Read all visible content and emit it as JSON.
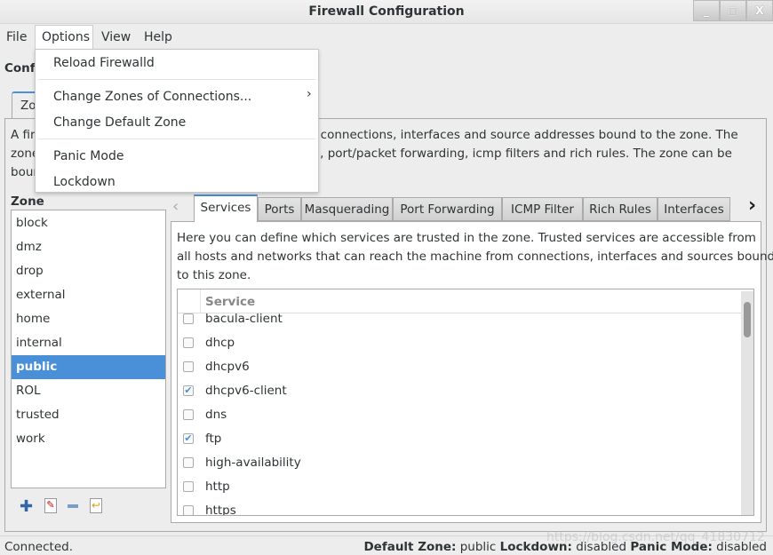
{
  "window": {
    "title": "Firewall Configuration",
    "minimize": "_",
    "maximize": "□",
    "close": "X"
  },
  "menubar": [
    "File",
    "Options",
    "View",
    "Help"
  ],
  "options_menu": {
    "reload": "Reload Firewalld",
    "change_zones": "Change Zones of Connections...",
    "change_default": "Change Default Zone",
    "panic": "Panic Mode",
    "lockdown": "Lockdown",
    "submenu_arrow": "›"
  },
  "partial": {
    "config_label": "Conf",
    "outer_tab": "Zo",
    "desc_left": [
      "A fir",
      "zone",
      "bour"
    ],
    "desc_right": [
      "rk connections, interfaces and source addresses bound to the zone. The",
      "ng, port/packet forwarding, icmp filters and rich rules. The zone can be"
    ]
  },
  "zone_label": "Zone",
  "zones": [
    "block",
    "dmz",
    "drop",
    "external",
    "home",
    "internal",
    "public",
    "ROL",
    "trusted",
    "work"
  ],
  "selected_zone": "public",
  "inner_tabs": [
    "Services",
    "Ports",
    "Masquerading",
    "Port Forwarding",
    "ICMP Filter",
    "Rich Rules",
    "Interfaces"
  ],
  "active_tab": "Services",
  "services_desc": [
    "Here you can define which services are trusted in the zone. Trusted services are accessible from",
    "all hosts and networks that can reach the machine from connections, interfaces and sources bound",
    "to this zone."
  ],
  "table_header": "Service",
  "services": [
    {
      "name": "bacula-client",
      "checked": false
    },
    {
      "name": "dhcp",
      "checked": false
    },
    {
      "name": "dhcpv6",
      "checked": false
    },
    {
      "name": "dhcpv6-client",
      "checked": true
    },
    {
      "name": "dns",
      "checked": false
    },
    {
      "name": "ftp",
      "checked": true
    },
    {
      "name": "high-availability",
      "checked": false
    },
    {
      "name": "http",
      "checked": false
    },
    {
      "name": "https",
      "checked": false
    }
  ],
  "status": {
    "left": "Connected.",
    "default_zone_label": "Default Zone:",
    "default_zone": "public",
    "lockdown_label": "Lockdown:",
    "lockdown": "disabled",
    "panic_label": "Panic Mode:",
    "panic": "disabled"
  },
  "watermark": "https://blog.csdn.net/qq_41830712"
}
